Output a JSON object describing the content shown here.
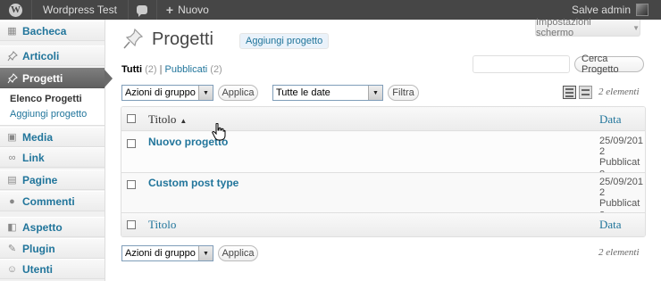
{
  "adminbar": {
    "site_name": "Wordpress Test",
    "new_label": "Nuovo",
    "greeting": "Salve admin"
  },
  "sidebar": {
    "items": [
      {
        "label": "Bacheca",
        "icon": "dashboard-icon"
      },
      {
        "label": "Articoli",
        "icon": "pushpin-icon"
      },
      {
        "label": "Progetti",
        "icon": "pushpin-icon"
      },
      {
        "label": "Media",
        "icon": "media-icon"
      },
      {
        "label": "Link",
        "icon": "link-icon"
      },
      {
        "label": "Pagine",
        "icon": "pages-icon"
      },
      {
        "label": "Commenti",
        "icon": "comment-icon"
      },
      {
        "label": "Aspetto",
        "icon": "appearance-icon"
      },
      {
        "label": "Plugin",
        "icon": "plugin-icon"
      },
      {
        "label": "Utenti",
        "icon": "users-icon"
      }
    ],
    "submenu": [
      "Elenco Progetti",
      "Aggiungi progetto"
    ]
  },
  "header": {
    "title": "Progetti",
    "add_new": "Aggiungi progetto",
    "screen_options": "Impostazioni schermo"
  },
  "filters": {
    "all_label": "Tutti",
    "all_count": "(2)",
    "separator": "|",
    "published_label": "Pubblicati",
    "published_count": "(2)",
    "search_value": "",
    "search_button": "Cerca Progetto",
    "bulk_action": "Azioni di gruppo",
    "apply": "Applica",
    "dates": "Tutte le date",
    "filter_button": "Filtra",
    "item_count": "2 elementi"
  },
  "table": {
    "col_title": "Titolo",
    "col_date": "Data",
    "rows": [
      {
        "title": "Nuovo progetto",
        "date": "25/09/2012",
        "status": "Pubblicato"
      },
      {
        "title": "Custom post type",
        "date": "25/09/2012",
        "status": "Pubblicato"
      }
    ]
  },
  "colors": {
    "accent": "#21759b",
    "adminbar": "#464646",
    "active_menu": "#6a6a6a"
  }
}
